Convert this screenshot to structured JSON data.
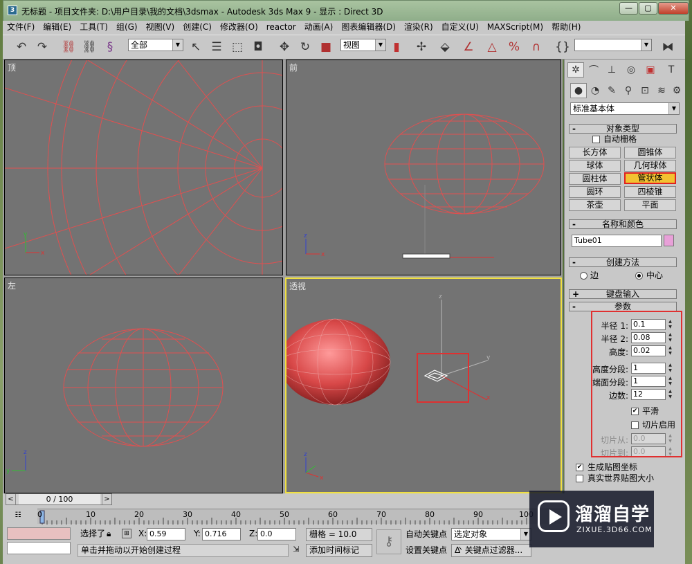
{
  "window": {
    "title": "无标题    - 项目文件夹: D:\\用户目录\\我的文档\\3dsmax      - Autodesk 3ds Max 9       - 显示 : Direct 3D",
    "min_label": "—",
    "max_label": "▢",
    "close_label": "✕"
  },
  "menu": [
    "文件(F)",
    "编辑(E)",
    "工具(T)",
    "组(G)",
    "视图(V)",
    "创建(C)",
    "修改器(O)",
    "reactor",
    "动画(A)",
    "图表编辑器(D)",
    "渲染(R)",
    "自定义(U)",
    "MAXScript(M)",
    "帮助(H)"
  ],
  "toolbar": {
    "selection_filter": "全部",
    "ref_coord": "视图",
    "named_selection": ""
  },
  "viewports": {
    "top": "顶",
    "front": "前",
    "left": "左",
    "persp": "透视"
  },
  "command_panel": {
    "category": "标准基本体",
    "object_type_title": "对象类型",
    "autogrid": "自动栅格",
    "object_buttons": [
      "长方体",
      "圆锥体",
      "球体",
      "几何球体",
      "圆柱体",
      "管状体",
      "圆环",
      "四棱锥",
      "茶壶",
      "平面"
    ],
    "selected_button": "管状体",
    "name_color_title": "名称和颜色",
    "object_name": "Tube01",
    "object_color": "#e8a0d8",
    "creation_method_title": "创建方法",
    "method_edge": "边",
    "method_center": "中心",
    "keyboard_input_title": "键盘输入",
    "params_title": "参数",
    "params": {
      "radius1_label": "半径 1:",
      "radius1": "0.1",
      "radius2_label": "半径 2:",
      "radius2": "0.08",
      "height_label": "高度:",
      "height": "0.02",
      "height_segs_label": "高度分段:",
      "height_segs": "1",
      "cap_segs_label": "端面分段:",
      "cap_segs": "1",
      "sides_label": "边数:",
      "sides": "12",
      "smooth_label": "平滑",
      "slice_on_label": "切片启用",
      "slice_from_label": "切片从:",
      "slice_from": "0.0",
      "slice_to_label": "切片到:",
      "slice_to": "0.0"
    },
    "gen_map_coords": "生成贴图坐标",
    "real_world_map": "真实世界贴图大小"
  },
  "timeline": {
    "frame_counter": "0 / 100",
    "ticks": [
      "0",
      "10",
      "20",
      "30",
      "40",
      "50",
      "60",
      "70",
      "80",
      "90",
      "100"
    ]
  },
  "status": {
    "selection_label": "选择了",
    "x_label": "X:",
    "x": "0.59",
    "y_label": "Y:",
    "y": "0.716",
    "z_label": "Z:",
    "z": "0.0",
    "grid": "栅格 = 10.0",
    "prompt": "单击并拖动以开始创建过程",
    "add_time_tag": "添加时间标记",
    "auto_key": "自动关键点",
    "set_key": "设置关键点",
    "key_mode": "选定对象",
    "key_filters": "关键点过滤器..."
  },
  "watermark": {
    "brand": "溜溜自学",
    "url": "ZIXUE.3D66.COM"
  }
}
